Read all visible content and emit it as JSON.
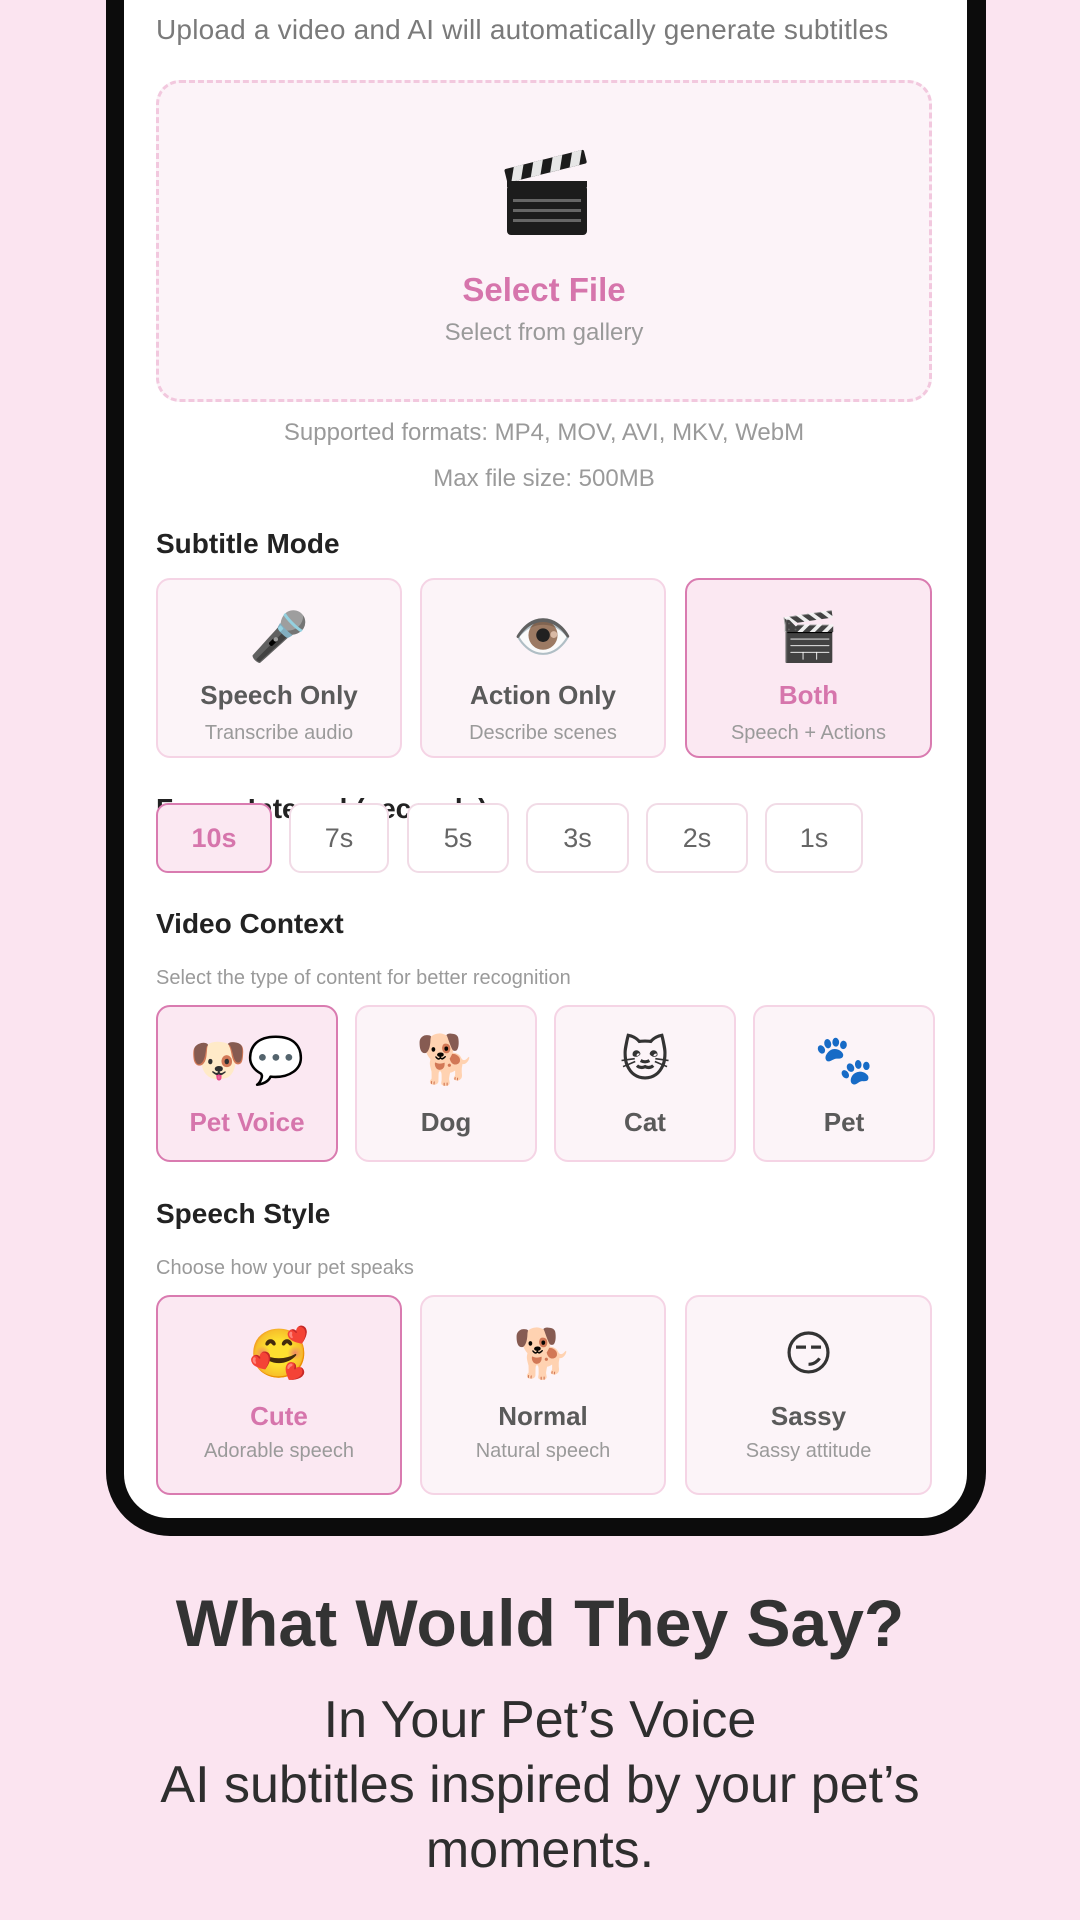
{
  "upload": {
    "intro": "Upload a video and AI will automatically generate subtitles",
    "icon": "clapperboard-icon",
    "title": "Select File",
    "subtitle": "Select from gallery",
    "formats": "Supported formats: MP4, MOV, AVI, MKV, WebM",
    "max_size": "Max file size: 500MB"
  },
  "subtitle_mode": {
    "title": "Subtitle Mode",
    "options": [
      {
        "emoji": "🎤",
        "label": "Speech Only",
        "sub": "Transcribe audio",
        "selected": false
      },
      {
        "emoji": "👁️",
        "label": "Action Only",
        "sub": "Describe scenes",
        "selected": false
      },
      {
        "emoji": "🎬",
        "label": "Both",
        "sub": "Speech + Actions",
        "selected": true
      }
    ]
  },
  "frame_interval": {
    "title": "Frame Interval (seconds)",
    "options": [
      "10s",
      "7s",
      "5s",
      "3s",
      "2s",
      "1s"
    ],
    "selected": "10s"
  },
  "video_context": {
    "title": "Video Context",
    "hint": "Select the type of content for better recognition",
    "options": [
      {
        "emoji": "🐶💬",
        "label": "Pet Voice",
        "selected": true
      },
      {
        "emoji": "🐕",
        "label": "Dog",
        "selected": false
      },
      {
        "emoji": "🐱",
        "label": "Cat",
        "selected": false
      },
      {
        "emoji": "🐾",
        "label": "Pet",
        "selected": false
      }
    ]
  },
  "speech_style": {
    "title": "Speech Style",
    "hint": "Choose how your pet speaks",
    "options": [
      {
        "emoji": "🥰",
        "label": "Cute",
        "sub": "Adorable speech",
        "selected": true
      },
      {
        "emoji": "🐕",
        "label": "Normal",
        "sub": "Natural speech",
        "selected": false
      },
      {
        "emoji": "😏",
        "label": "Sassy",
        "sub": "Sassy attitude",
        "selected": false
      }
    ]
  },
  "promo": {
    "headline": "What Would They Say?",
    "line1": "In Your Pet’s Voice",
    "line2": "AI subtitles inspired by your pet’s moments."
  },
  "colors": {
    "accent": "#d675ac",
    "background": "#fbe4f0"
  }
}
